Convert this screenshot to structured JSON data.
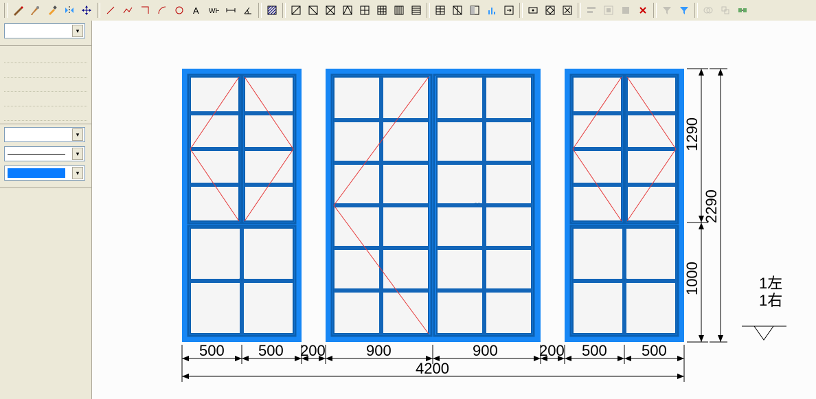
{
  "toolbar": {
    "btns": [
      "pick",
      "brush",
      "dropper",
      "mirror",
      "move",
      "line",
      "polyline",
      "rect",
      "arc",
      "circle",
      "text",
      "text2",
      "dim-h",
      "dim-angle",
      "grid1",
      "diag1",
      "diag2",
      "diag3",
      "cross",
      "grid3x",
      "grid4x",
      "stripes",
      "list",
      "grid2x3",
      "diag-box",
      "grid-shade",
      "bars",
      "arrow-box",
      "back",
      "diamond",
      "box-x",
      "align1",
      "align2",
      "align3",
      "delete",
      "filter",
      "shape-a",
      "shape-b",
      "merge"
    ]
  },
  "side": {
    "combo_top": "",
    "color_selected": "#0a7cff"
  },
  "drawing": {
    "bottom_dims": [
      "500",
      "500",
      "200",
      "900",
      "900",
      "200",
      "500",
      "500"
    ],
    "total_width": "4200",
    "right_dims": [
      "1290",
      "1000"
    ],
    "right_total": "2290",
    "notes": [
      "1左",
      "1右"
    ]
  }
}
